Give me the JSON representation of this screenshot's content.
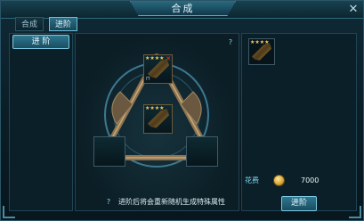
{
  "window": {
    "title": "合成",
    "close_glyph": "✕"
  },
  "tabs": [
    {
      "label": "合成",
      "active": false
    },
    {
      "label": "进阶",
      "active": true
    }
  ],
  "sidebar": {
    "items": [
      {
        "label": "进 阶",
        "selected": true
      }
    ]
  },
  "center": {
    "help_icon": "help-icon",
    "slots": {
      "top": {
        "has_item": true,
        "stars": "★★★★",
        "removable": true,
        "remove_glyph": "✕",
        "locked": true,
        "lock_glyph": "⊓"
      },
      "middle": {
        "has_item": true,
        "stars": "★★★★",
        "removable": false,
        "locked": false
      },
      "left": {
        "has_item": false
      },
      "right": {
        "has_item": false
      }
    },
    "notice_text": "进阶后将会重新随机生成特殊属性"
  },
  "right_panel": {
    "result_slot": {
      "has_item": true,
      "stars": "★★★★"
    },
    "cost_label": "花费",
    "cost_icon": "gold-coin-icon",
    "cost_value": "7000",
    "advance_button": "进阶"
  },
  "colors": {
    "accent": "#7ccae3",
    "panel_bg": "#0b1f28",
    "gold": "#d9a83a",
    "remove_red": "#ff3030"
  }
}
